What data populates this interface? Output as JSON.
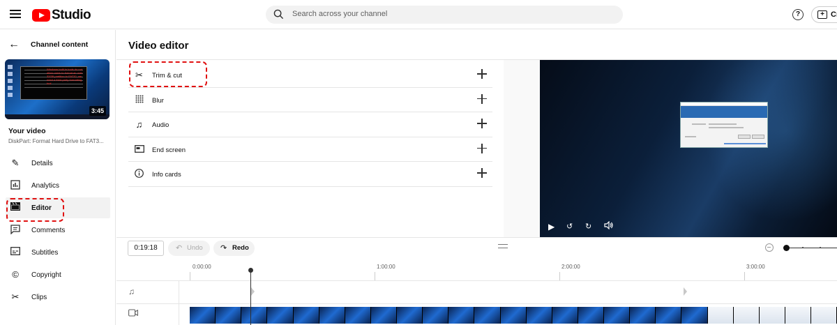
{
  "header": {
    "logo_text": "Studio",
    "search_placeholder": "Search across your channel",
    "create_label": "Cr",
    "help_label": "?"
  },
  "sidebar": {
    "back_label": "Channel content",
    "thumbnail_duration": "3:45",
    "thumbnail_overlay_text": "Windows built-in tools do not allow users to format an over 32GB partition to FAT32, we need a third-party formatting tool",
    "your_video_label": "Your video",
    "video_title": "DiskPart: Format Hard Drive to FAT3...",
    "nav": [
      {
        "label": "Details",
        "icon": "pencil-icon",
        "active": false
      },
      {
        "label": "Analytics",
        "icon": "analytics-icon",
        "active": false
      },
      {
        "label": "Editor",
        "icon": "clapperboard-icon",
        "active": true
      },
      {
        "label": "Comments",
        "icon": "comments-icon",
        "active": false
      },
      {
        "label": "Subtitles",
        "icon": "subtitles-icon",
        "active": false
      },
      {
        "label": "Copyright",
        "icon": "copyright-icon",
        "active": false
      },
      {
        "label": "Clips",
        "icon": "scissors-icon",
        "active": false
      }
    ]
  },
  "main": {
    "title": "Video editor",
    "tools": [
      {
        "label": "Trim & cut",
        "icon": "scissors-icon"
      },
      {
        "label": "Blur",
        "icon": "blur-grid-icon"
      },
      {
        "label": "Audio",
        "icon": "music-note-icon"
      },
      {
        "label": "End screen",
        "icon": "end-screen-icon"
      },
      {
        "label": "Info cards",
        "icon": "info-icon"
      }
    ],
    "highlight_color": "#e01010"
  },
  "timeline": {
    "current_time": "0:19:18",
    "undo_label": "Undo",
    "redo_label": "Redo",
    "ruler": [
      "0:00:00",
      "1:00:00",
      "2:00:00",
      "3:00:00"
    ],
    "tracks": [
      "audio-track-icon",
      "video-track-icon"
    ],
    "zoom_level": 0.0
  }
}
